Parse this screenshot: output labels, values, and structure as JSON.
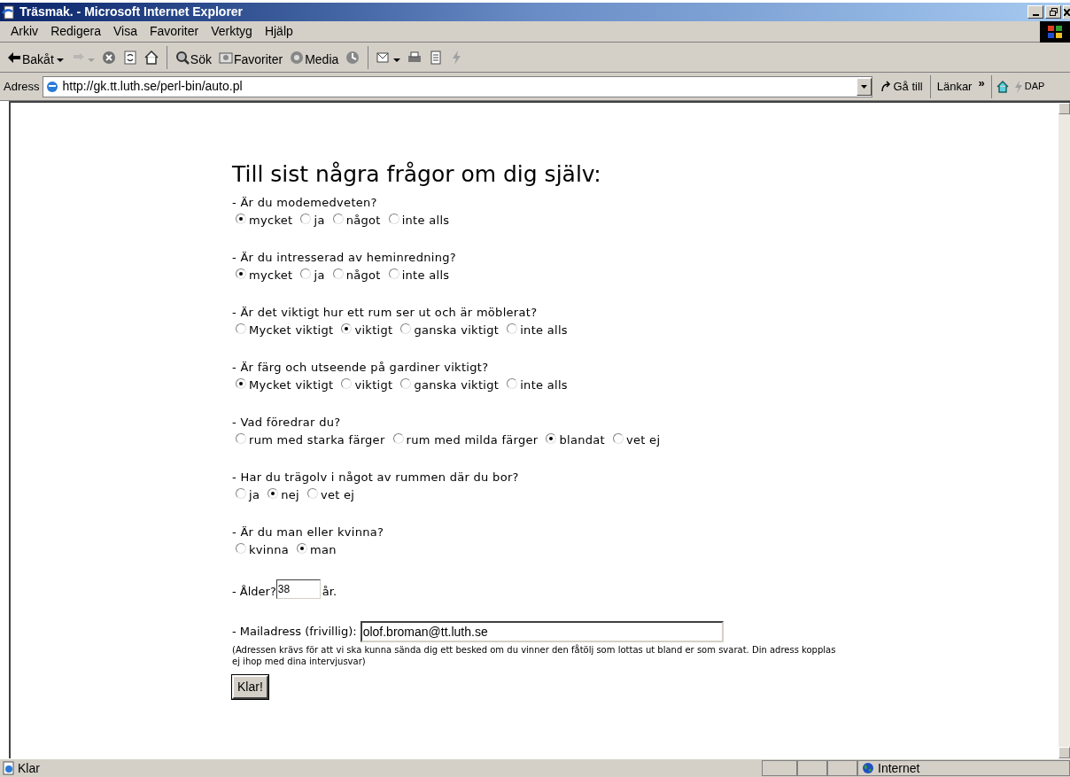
{
  "window": {
    "title": "Träsmak. - Microsoft Internet Explorer"
  },
  "menu": [
    "Arkiv",
    "Redigera",
    "Visa",
    "Favoriter",
    "Verktyg",
    "Hjälp"
  ],
  "toolbar": [
    {
      "kind": "back",
      "label": "Bakåt",
      "disabled": false
    },
    {
      "kind": "forward",
      "disabled": true
    },
    {
      "kind": "stop",
      "disabled": false
    },
    {
      "kind": "refresh",
      "disabled": false
    },
    {
      "kind": "home",
      "disabled": false
    },
    {
      "kind": "sep"
    },
    {
      "kind": "search",
      "label": "Sök",
      "disabled": false
    },
    {
      "kind": "favorites",
      "label": "Favoriter",
      "disabled": false
    },
    {
      "kind": "media",
      "label": "Media",
      "disabled": false
    },
    {
      "kind": "history",
      "disabled": false
    },
    {
      "kind": "sep"
    },
    {
      "kind": "mail",
      "disabled": false
    },
    {
      "kind": "print",
      "disabled": false
    },
    {
      "kind": "edit",
      "disabled": false
    },
    {
      "kind": "lightning",
      "disabled": false
    }
  ],
  "address_bar": {
    "label": "Adress",
    "url": "http://gk.tt.luth.se/perl-bin/auto.pl",
    "go": "Gå till",
    "links": "Länkar",
    "chevron": "»",
    "link_item": "DAP"
  },
  "page": {
    "heading": "Till sist några frågor om dig själv:",
    "questions": [
      {
        "label": "- Är du modemedveten?",
        "options": [
          {
            "label": "mycket",
            "selected": true
          },
          {
            "label": "ja",
            "selected": false
          },
          {
            "label": "något",
            "selected": false
          },
          {
            "label": "inte alls",
            "selected": false
          }
        ]
      },
      {
        "label": "- Är du intresserad av heminredning?",
        "options": [
          {
            "label": "mycket",
            "selected": true
          },
          {
            "label": "ja",
            "selected": false
          },
          {
            "label": "något",
            "selected": false
          },
          {
            "label": "inte alls",
            "selected": false
          }
        ]
      },
      {
        "label": "- Är det viktigt hur ett rum ser ut och är möblerat?",
        "options": [
          {
            "label": "Mycket viktigt",
            "selected": false
          },
          {
            "label": "viktigt",
            "selected": true
          },
          {
            "label": "ganska viktigt",
            "selected": false
          },
          {
            "label": "inte alls",
            "selected": false
          }
        ]
      },
      {
        "label": "- Är färg och utseende på gardiner viktigt?",
        "options": [
          {
            "label": "Mycket viktigt",
            "selected": true
          },
          {
            "label": "viktigt",
            "selected": false
          },
          {
            "label": "ganska viktigt",
            "selected": false
          },
          {
            "label": "inte alls",
            "selected": false
          }
        ]
      },
      {
        "label": "- Vad föredrar du?",
        "options": [
          {
            "label": "rum med starka färger",
            "selected": false
          },
          {
            "label": "rum med milda färger",
            "selected": false
          },
          {
            "label": "blandat",
            "selected": true
          },
          {
            "label": "vet ej",
            "selected": false
          }
        ]
      },
      {
        "label": "- Har du trägolv i något av rummen där du bor?",
        "options": [
          {
            "label": "ja",
            "selected": false
          },
          {
            "label": "nej",
            "selected": true
          },
          {
            "label": "vet ej",
            "selected": false
          }
        ]
      },
      {
        "label": "- Är du man eller kvinna?",
        "options": [
          {
            "label": "kvinna",
            "selected": false
          },
          {
            "label": "man",
            "selected": true
          }
        ]
      }
    ],
    "age": {
      "label": "- Ålder?",
      "value": "38",
      "suffix": "år."
    },
    "email": {
      "label": "- Mailadress (frivillig):",
      "value": "olof.broman@tt.luth.se"
    },
    "note": "(Adressen krävs för att vi ska kunna sända dig ett besked om du vinner den fåtölj som lottas ut bland er som svarat. Din adress kopplas ej ihop med dina intervjusvar)",
    "submit": "Klar!"
  },
  "status_bar": {
    "text": "Klar",
    "zone": "Internet"
  }
}
